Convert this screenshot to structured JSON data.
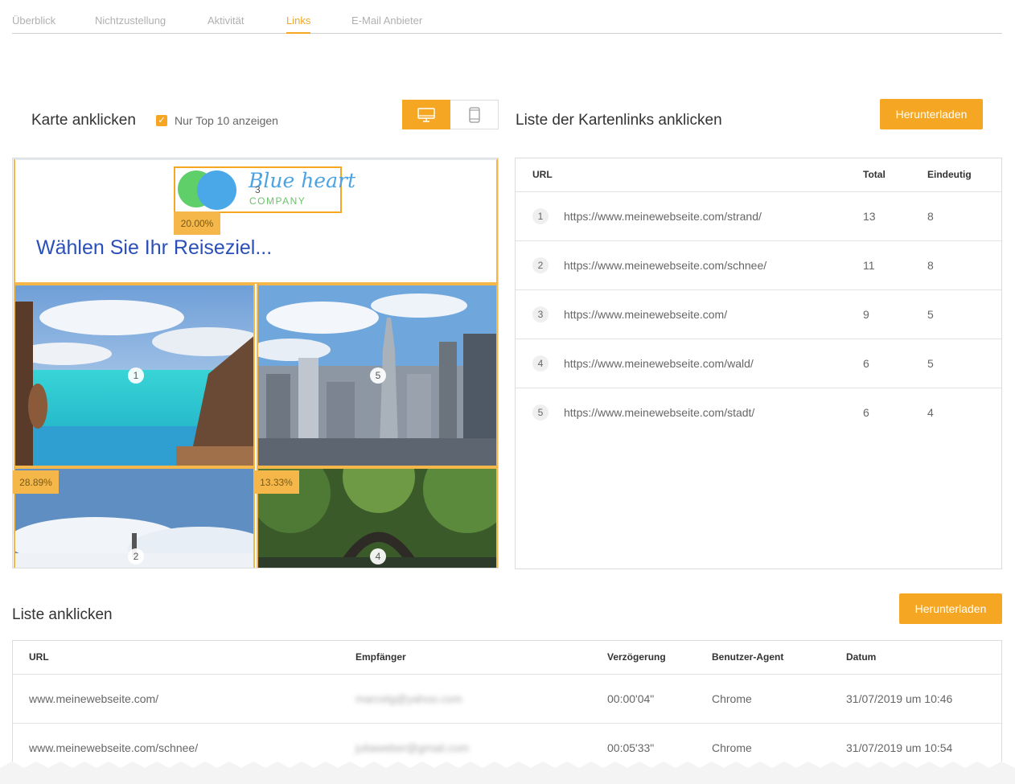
{
  "tabs": [
    {
      "label": "Überblick",
      "active": false
    },
    {
      "label": "Nichtzustellung",
      "active": false
    },
    {
      "label": "Aktivität",
      "active": false
    },
    {
      "label": "Links",
      "active": true
    },
    {
      "label": "E-Mail Anbieter",
      "active": false
    }
  ],
  "click_map": {
    "title": "Karte anklicken",
    "top10_label": "Nur Top 10 anzeigen",
    "top10_checked": true,
    "device_toggle": [
      "desktop-icon",
      "mobile-icon"
    ],
    "logo": {
      "title": "Blue heart",
      "subtitle": "COMPANY"
    },
    "headline": "Wählen Sie Ihr Reiseziel...",
    "markers": [
      "3",
      "1",
      "5",
      "2",
      "4"
    ],
    "badges": [
      "20.00%",
      "28.89%",
      "13.33%"
    ]
  },
  "links_list": {
    "title": "Liste der Kartenlinks anklicken",
    "download_label": "Herunterladen",
    "columns": [
      "URL",
      "Total",
      "Eindeutig"
    ],
    "rows": [
      {
        "idx": "1",
        "url": "https://www.meinewebseite.com/strand/",
        "total": "13",
        "unique": "8"
      },
      {
        "idx": "2",
        "url": "https://www.meinewebseite.com/schnee/",
        "total": "11",
        "unique": "8"
      },
      {
        "idx": "3",
        "url": "https://www.meinewebseite.com/",
        "total": "9",
        "unique": "5"
      },
      {
        "idx": "4",
        "url": "https://www.meinewebseite.com/wald/",
        "total": "6",
        "unique": "5"
      },
      {
        "idx": "5",
        "url": "https://www.meinewebseite.com/stadt/",
        "total": "6",
        "unique": "4"
      }
    ]
  },
  "click_list": {
    "title": "Liste anklicken",
    "download_label": "Herunterladen",
    "columns": [
      "URL",
      "Empfänger",
      "Verzögerung",
      "Benutzer-Agent",
      "Datum"
    ],
    "rows": [
      {
        "url": "www.meinewebseite.com/",
        "recipient": "marcelg@yahoo.com",
        "delay": "00:00'04\"",
        "agent": "Chrome",
        "date": "31/07/2019 um 10:46"
      },
      {
        "url": "www.meinewebseite.com/schnee/",
        "recipient": "juliaweber@gmail.com",
        "delay": "00:05'33\"",
        "agent": "Chrome",
        "date": "31/07/2019 um 10:54"
      }
    ]
  },
  "colors": {
    "accent": "#f5a623",
    "headline": "#2a4fb8"
  }
}
